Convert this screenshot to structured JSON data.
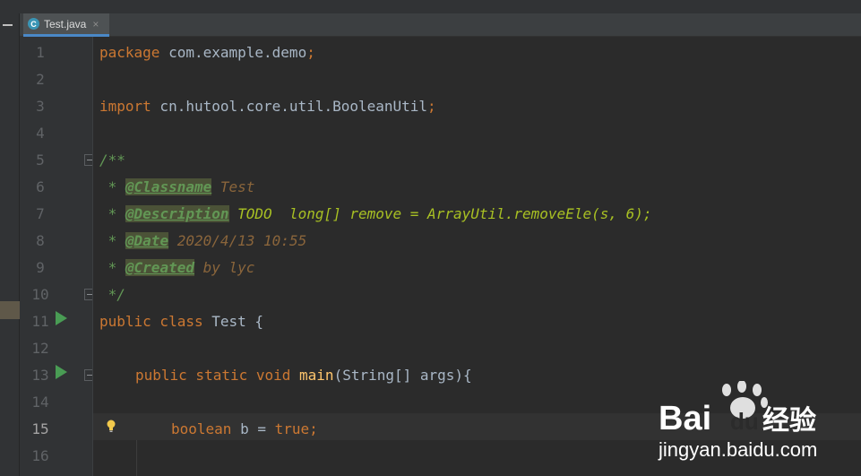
{
  "tab": {
    "label": "Test.java",
    "icon": "class-icon",
    "icon_letter": "C",
    "close": "×"
  },
  "line_numbers": [
    "1",
    "2",
    "3",
    "4",
    "5",
    "6",
    "7",
    "8",
    "9",
    "10",
    "11",
    "12",
    "13",
    "14",
    "15",
    "16"
  ],
  "current_line": "15",
  "code": {
    "l1": {
      "kw": "package",
      "rest": " com.example.demo",
      "semi": ";"
    },
    "l3": {
      "kw": "import",
      "rest": " cn.hutool.core.util.BooleanUtil",
      "semi": ";"
    },
    "l5": {
      "text": "/**"
    },
    "l6": {
      "star": " * ",
      "tag": "@Classname",
      "text": " Test"
    },
    "l7": {
      "star": " * ",
      "tag": "@Description",
      "text": " TODO  long[] remove = ArrayUtil.removeEle(s, 6);"
    },
    "l8": {
      "star": " * ",
      "tag": "@Date",
      "text": " 2020/4/13 10:55"
    },
    "l9": {
      "star": " * ",
      "tag": "@Created",
      "text": " by lyc"
    },
    "l10": {
      "text": " */"
    },
    "l11": {
      "kw": "public class",
      "rest": " Test {"
    },
    "l13": {
      "kw": "public static void",
      "fn": "main",
      "rest": "(String[] args){"
    },
    "l15": {
      "kw1": "boolean",
      "mid": " b = ",
      "kw2": "true",
      "semi": ";"
    }
  },
  "watermark": {
    "brand": "Bai",
    "brand2": "du",
    "cn": "经验",
    "url": "jingyan.baidu.com"
  }
}
